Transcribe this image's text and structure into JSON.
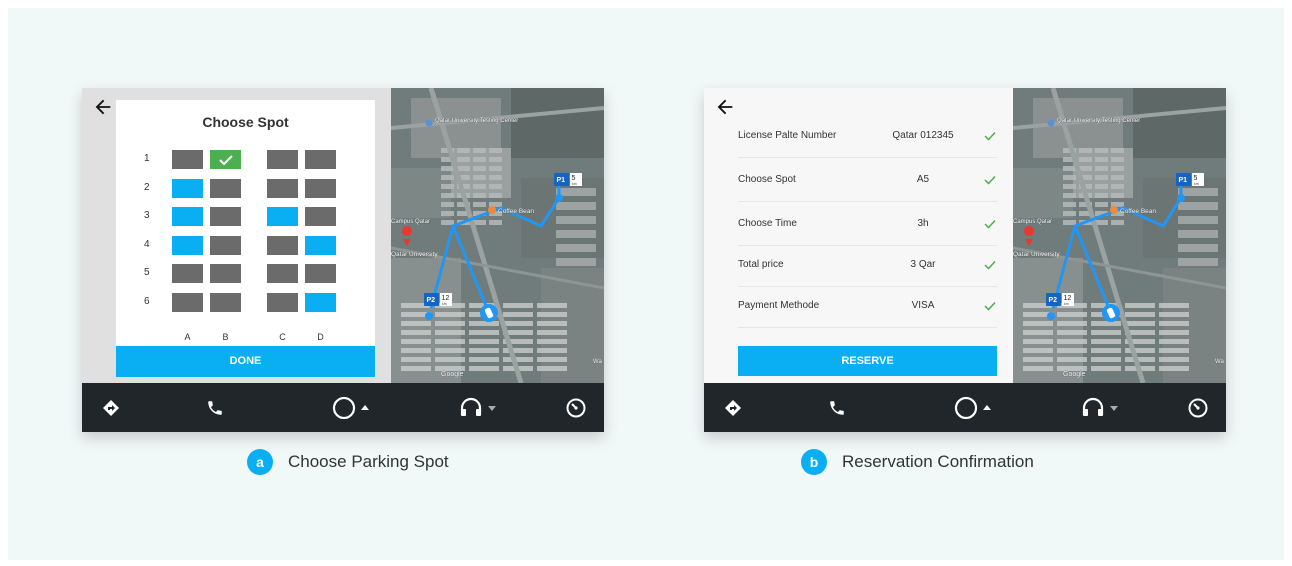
{
  "screen_a": {
    "title": "Choose Spot",
    "rows": [
      {
        "num": "1",
        "cells": [
          "taken",
          "selected",
          "taken",
          "taken"
        ]
      },
      {
        "num": "2",
        "cells": [
          "free",
          "taken",
          "taken",
          "taken"
        ]
      },
      {
        "num": "3",
        "cells": [
          "free",
          "taken",
          "free",
          "taken"
        ]
      },
      {
        "num": "4",
        "cells": [
          "free",
          "taken",
          "taken",
          "free"
        ]
      },
      {
        "num": "5",
        "cells": [
          "taken",
          "taken",
          "taken",
          "taken"
        ]
      },
      {
        "num": "6",
        "cells": [
          "taken",
          "taken",
          "taken",
          "free"
        ]
      }
    ],
    "columns": [
      "A",
      "B",
      "C",
      "D"
    ],
    "done_label": "DONE",
    "caption_badge": "a",
    "caption": "Choose Parking Spot"
  },
  "screen_b": {
    "rows": [
      {
        "label": "License Palte Number",
        "value": "Qatar 012345"
      },
      {
        "label": "Choose Spot",
        "value": "A5"
      },
      {
        "label": "Choose Time",
        "value": "3h"
      },
      {
        "label": "Total price",
        "value": "3 Qar"
      },
      {
        "label": "Payment Methode",
        "value": "VISA"
      }
    ],
    "reserve_label": "RESERVE",
    "caption_badge": "b",
    "caption": "Reservation Confirmation"
  },
  "map": {
    "labels": {
      "qu_center": "Qatar University Testing Center",
      "coffee": "Coffee Bean",
      "campus": "Campus Qatar",
      "university": "Qatar University",
      "google": "Google",
      "edge": "Wa"
    },
    "markers": [
      {
        "name": "P1",
        "distance": "5",
        "unit": "km"
      },
      {
        "name": "P2",
        "distance": "12",
        "unit": "km"
      }
    ]
  },
  "navbar": {
    "icons": [
      "navigation-icon",
      "phone-icon",
      "home-circle-icon",
      "headphones-icon",
      "speedometer-icon"
    ]
  },
  "colors": {
    "accent": "#0aaef3",
    "taken": "#6b6b6b",
    "selected": "#4caf50",
    "navbar": "#20262a",
    "background": "#f1f8f8"
  }
}
